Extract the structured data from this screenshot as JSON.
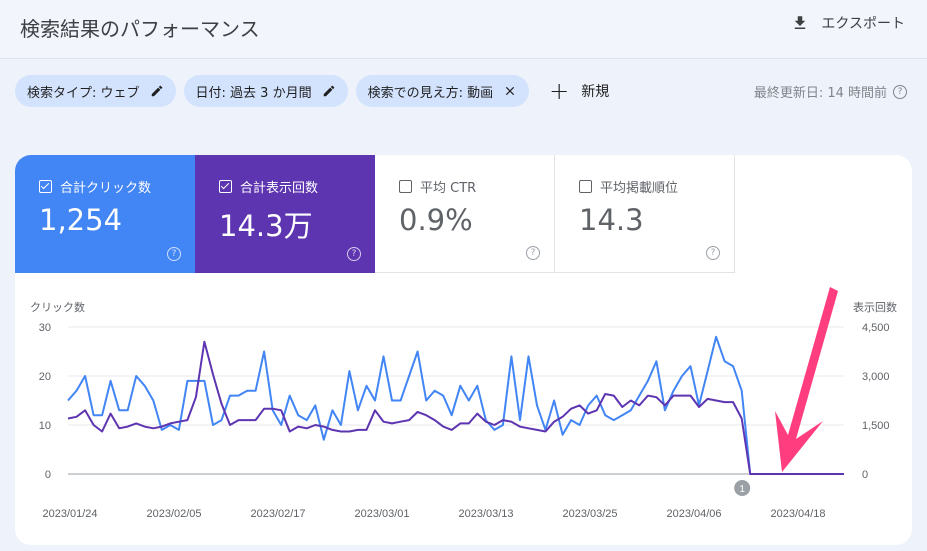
{
  "header": {
    "title": "検索結果のパフォーマンス",
    "export_label": "エクスポート",
    "export_icon": "download-icon"
  },
  "filters": {
    "chips": [
      {
        "label": "検索タイプ: ウェブ",
        "icon": "edit-icon"
      },
      {
        "label": "日付: 過去 3 か月間",
        "icon": "edit-icon"
      },
      {
        "label": "検索での見え方: 動画",
        "icon": "close-icon"
      }
    ],
    "new_label": "新規",
    "updated_text": "最終更新日: 14 時間前"
  },
  "metrics": [
    {
      "label": "合計クリック数",
      "value": "1,254",
      "checked": true,
      "color": "#4285f4"
    },
    {
      "label": "合計表示回数",
      "value": "14.3万",
      "checked": true,
      "color": "#5e35b1"
    },
    {
      "label": "平均 CTR",
      "value": "0.9%",
      "checked": false
    },
    {
      "label": "平均掲載順位",
      "value": "14.3",
      "checked": false
    }
  ],
  "chart_data": {
    "type": "line",
    "left_axis_label": "クリック数",
    "right_axis_label": "表示回数",
    "left_ticks": [
      "30",
      "20",
      "10",
      "0"
    ],
    "right_ticks": [
      "4,500",
      "3,000",
      "1,500",
      "0"
    ],
    "left_ylim": [
      0,
      30
    ],
    "right_ylim": [
      0,
      4500
    ],
    "x_tick_labels": [
      "2023/01/24",
      "2023/02/05",
      "2023/02/17",
      "2023/03/01",
      "2023/03/13",
      "2023/03/25",
      "2023/04/06",
      "2023/04/18"
    ],
    "annotation": "1",
    "series": [
      {
        "name": "クリック数",
        "axis": "left",
        "color": "#4285f4",
        "values": [
          15,
          17,
          20,
          12,
          12,
          19,
          13,
          13,
          20,
          18,
          15,
          9,
          10,
          9,
          19,
          19,
          19,
          10,
          11,
          16,
          16,
          17,
          17,
          25,
          13,
          10,
          16,
          12,
          11,
          14,
          7,
          13,
          10,
          21,
          13,
          18,
          15,
          24,
          15,
          15,
          20,
          25,
          15,
          17,
          16,
          12,
          18,
          15,
          18,
          11,
          9,
          10,
          24,
          11,
          24,
          14,
          9,
          15,
          8,
          11,
          10,
          14,
          16,
          12,
          11,
          12,
          13,
          16,
          19,
          23,
          13,
          17,
          20,
          22,
          14,
          21,
          28,
          23,
          22,
          17,
          0,
          0,
          0,
          0,
          0,
          0,
          0,
          0,
          0,
          0,
          0,
          0
        ]
      },
      {
        "name": "表示回数",
        "axis": "right",
        "color": "#5e35b1",
        "values": [
          1700,
          1750,
          1950,
          1500,
          1300,
          1850,
          1400,
          1450,
          1550,
          1450,
          1400,
          1450,
          1550,
          1600,
          1650,
          2350,
          4050,
          3050,
          2150,
          1500,
          1650,
          1650,
          1650,
          2000,
          2000,
          1950,
          1300,
          1450,
          1400,
          1500,
          1450,
          1350,
          1300,
          1300,
          1350,
          1350,
          1950,
          1600,
          1550,
          1600,
          1650,
          1900,
          1800,
          1650,
          1450,
          1350,
          1550,
          1550,
          1850,
          1600,
          1500,
          1650,
          1600,
          1450,
          1400,
          1350,
          1300,
          1600,
          1750,
          2000,
          2100,
          1850,
          1950,
          2450,
          2400,
          2050,
          2250,
          2100,
          2400,
          2350,
          2100,
          2400,
          2400,
          2400,
          2050,
          2300,
          2250,
          2200,
          2200,
          1700,
          0,
          0,
          0,
          0,
          0,
          0,
          0,
          0,
          0,
          0,
          0,
          0
        ]
      }
    ]
  }
}
